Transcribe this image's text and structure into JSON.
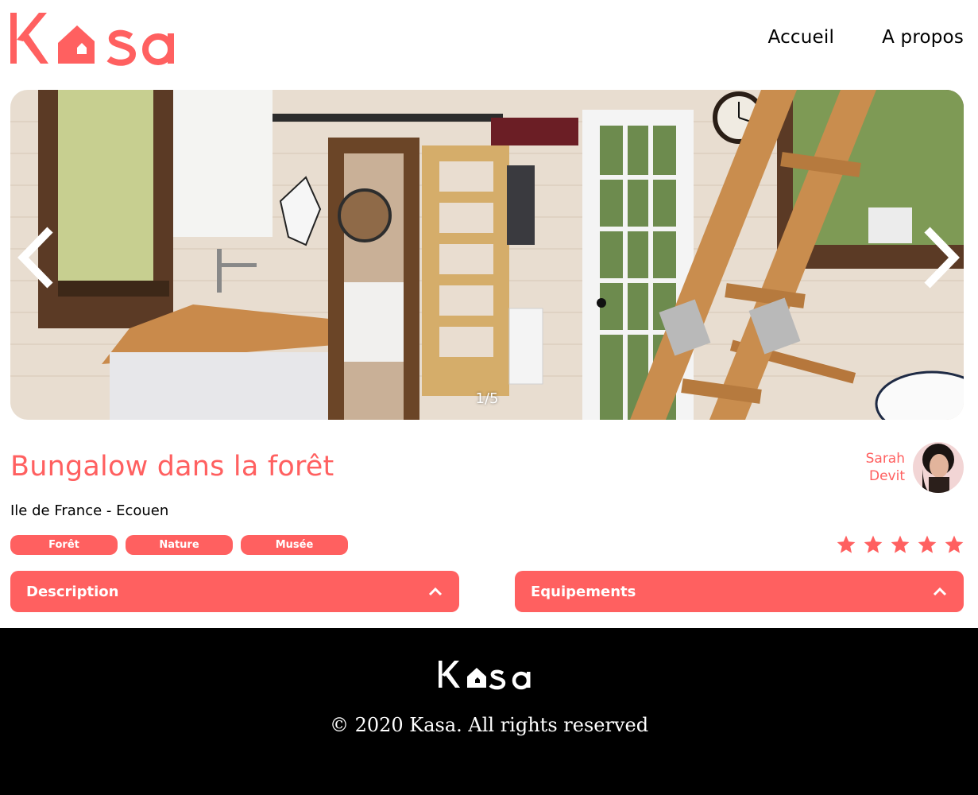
{
  "header": {
    "logo_text": "Kasa",
    "nav": [
      {
        "label": "Accueil"
      },
      {
        "label": "A propos"
      }
    ]
  },
  "gallery": {
    "counter": "1/5",
    "current": 1,
    "total": 5,
    "prev_icon": "chevron-left-icon",
    "next_icon": "chevron-right-icon"
  },
  "listing": {
    "title": "Bungalow dans la forêt",
    "location": "Ile de France - Ecouen",
    "tags": [
      "Forêt",
      "Nature",
      "Musée"
    ],
    "rating": 5,
    "rating_max": 5
  },
  "host": {
    "first_name": "Sarah",
    "last_name": "Devit"
  },
  "collapses": {
    "description": "Description",
    "equipments": "Equipements",
    "chevron_icon": "chevron-up-icon"
  },
  "footer": {
    "logo_text": "Kasa",
    "copyright": "© 2020 Kasa. All rights reserved"
  },
  "colors": {
    "brand": "#FF6060",
    "footer_bg": "#000000",
    "text": "#000000"
  }
}
